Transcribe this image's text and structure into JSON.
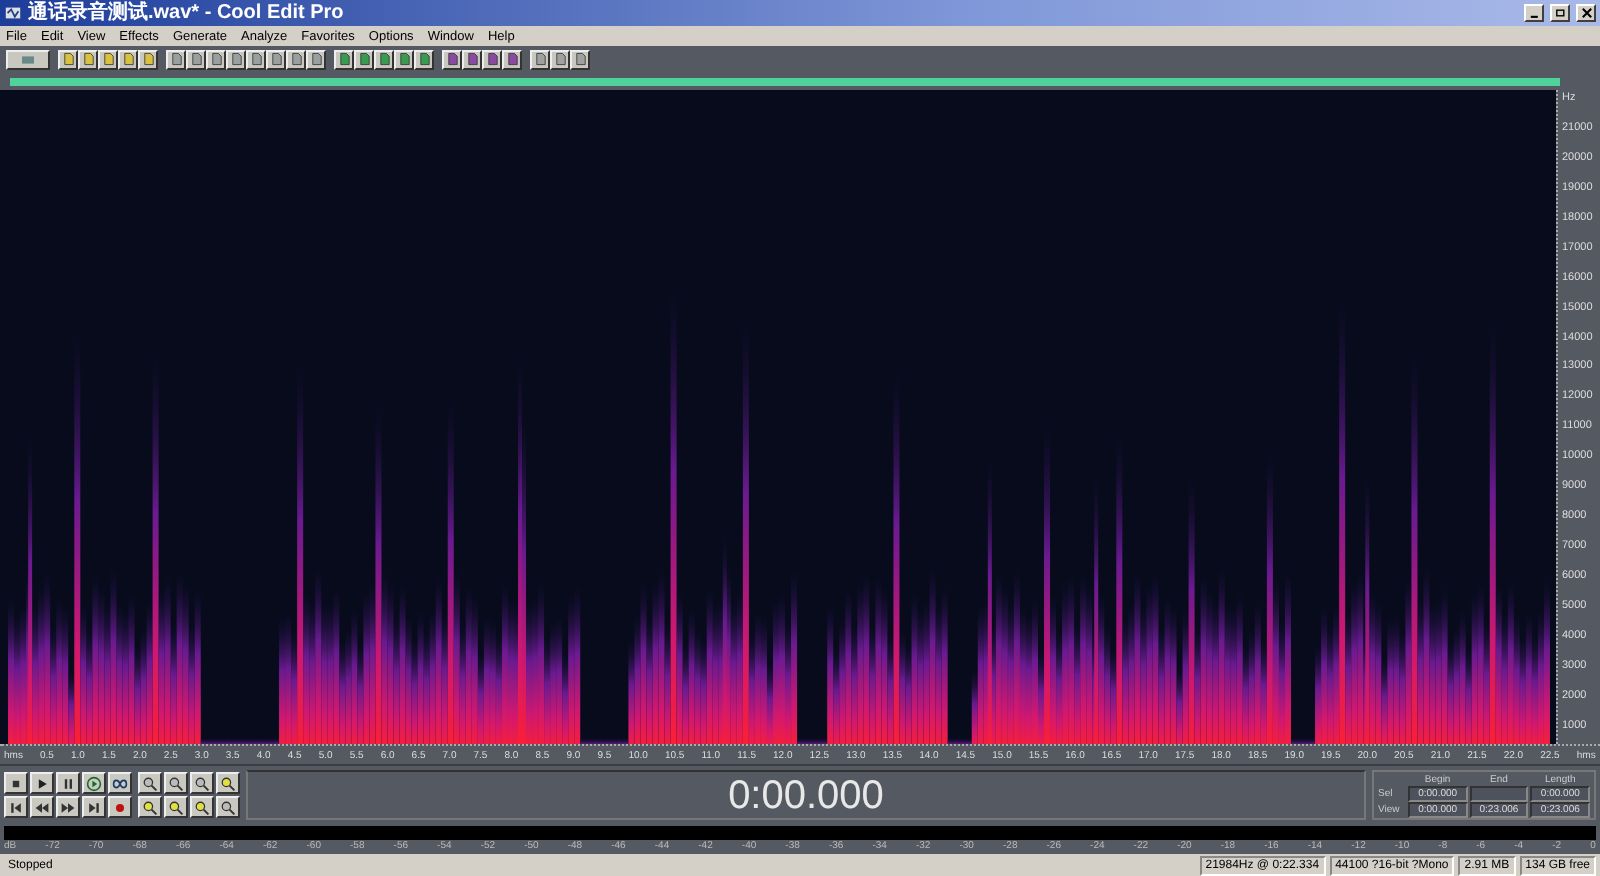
{
  "window": {
    "title": "通话录音测试.wav* - Cool Edit Pro"
  },
  "menu": [
    "File",
    "Edit",
    "View",
    "Effects",
    "Generate",
    "Analyze",
    "Favorites",
    "Options",
    "Window",
    "Help"
  ],
  "frequency_axis": {
    "unit": "Hz",
    "ticks": [
      "21000",
      "20000",
      "19000",
      "18000",
      "17000",
      "16000",
      "15000",
      "14000",
      "13000",
      "12000",
      "11000",
      "10000",
      "9000",
      "8000",
      "7000",
      "6000",
      "5000",
      "4000",
      "3000",
      "2000",
      "1000"
    ]
  },
  "time_axis": {
    "labels": [
      "hms",
      "0.5",
      "1.0",
      "1.5",
      "2.0",
      "2.5",
      "3.0",
      "3.5",
      "4.0",
      "4.5",
      "5.0",
      "5.5",
      "6.0",
      "6.5",
      "7.0",
      "7.5",
      "8.0",
      "8.5",
      "9.0",
      "9.5",
      "10.0",
      "10.5",
      "11.0",
      "11.5",
      "12.0",
      "12.5",
      "13.0",
      "13.5",
      "14.0",
      "14.5",
      "15.0",
      "15.5",
      "16.0",
      "16.5",
      "17.0",
      "17.5",
      "18.0",
      "18.5",
      "19.0",
      "19.5",
      "20.0",
      "20.5",
      "21.0",
      "21.5",
      "22.0",
      "22.5",
      "hms"
    ]
  },
  "time_display": "0:00.000",
  "selection": {
    "columns": [
      "Begin",
      "End",
      "Length"
    ],
    "rows": [
      {
        "label": "Sel",
        "begin": "0:00.000",
        "length": "0:00.000"
      },
      {
        "label": "View",
        "begin": "0:00.000",
        "end": "0:23.006",
        "length": "0:23.006"
      }
    ]
  },
  "level_meter": {
    "scale": [
      "dB",
      "-72",
      "-70",
      "-68",
      "-66",
      "-64",
      "-62",
      "-60",
      "-58",
      "-56",
      "-54",
      "-52",
      "-50",
      "-48",
      "-46",
      "-44",
      "-42",
      "-40",
      "-38",
      "-36",
      "-34",
      "-32",
      "-30",
      "-28",
      "-26",
      "-24",
      "-22",
      "-20",
      "-18",
      "-16",
      "-14",
      "-12",
      "-10",
      "-8",
      "-6",
      "-4",
      "-2",
      "0"
    ]
  },
  "status_bar": [
    "Stopped",
    "21984Hz @ 0:22.334",
    "44100 ?16-bit ?Mono",
    "2.91 MB",
    "134 GB free"
  ]
}
